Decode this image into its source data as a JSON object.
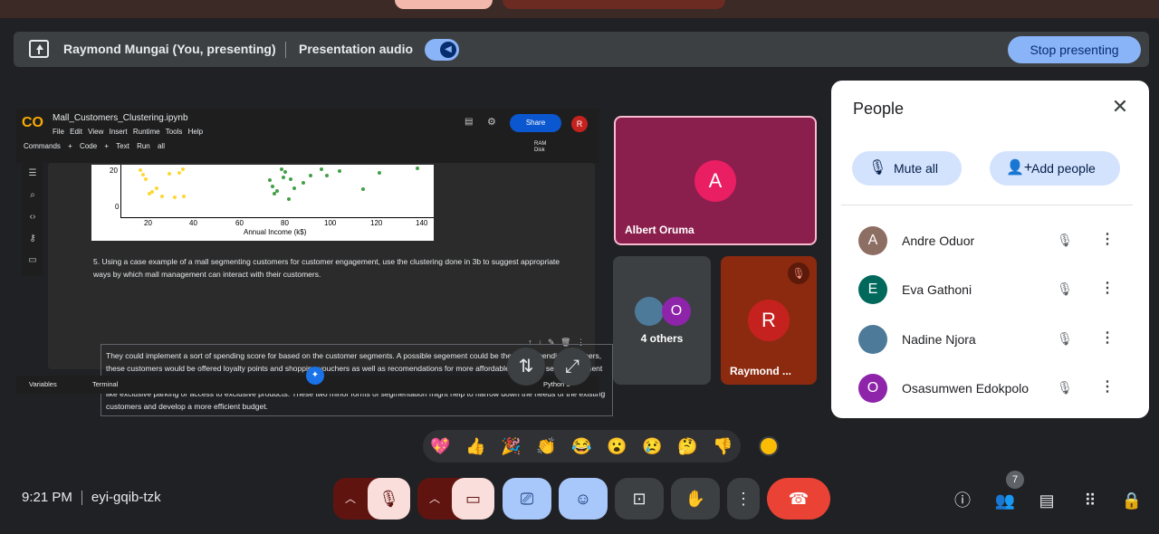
{
  "presenting_bar": {
    "presenter_name": "Raymond Mungai (You, presenting)",
    "audio_label": "Presentation audio",
    "audio_on": true,
    "stop_label": "Stop presenting"
  },
  "colab": {
    "logo": "CO",
    "title": "Mall_Customers_Clustering.ipynb",
    "menu": [
      "File",
      "Edit",
      "View",
      "Insert",
      "Runtime",
      "Tools",
      "Help"
    ],
    "share_label": "Share",
    "avatar_initial": "R",
    "toolbar": [
      "Commands",
      "+ Code",
      "+ Text",
      "Run all"
    ],
    "resources": "RAM\nDisk",
    "plot": {
      "xlabel": "Annual Income (k$)",
      "xticks": [
        "20",
        "40",
        "60",
        "80",
        "100",
        "120",
        "140"
      ],
      "yticks": [
        "20",
        "0"
      ]
    },
    "question": "5. Using a case example of a mall segmenting customers for customer engagement, use the clustering done in 3b to suggest appropriate ways by which mall management can interact with their customers.",
    "answer": "They could implement a sort of spending score for based on the customer segments. A possible segement could be the lower spending shoppers, these customers would be offered loyalty points and shopping vouchers as well as recomendations for more affordable brands. a second segment could be the high spending customers, these are the ones who would be opting for luxury items. These customers might be offered special perks like exclusive parking or access to exclusive products. These two minor forms of segmentation might help to narrow down the needs of the existing customers and develop a more efficient budget.",
    "status": {
      "variables": "Variables",
      "terminal": "Terminal",
      "python": "Python 3"
    }
  },
  "tiles": {
    "albert": {
      "initial": "A",
      "name": "Albert Oruma",
      "color": "#e91e63"
    },
    "others": {
      "label": "4 others",
      "initial": "O"
    },
    "raymond": {
      "initial": "R",
      "name": "Raymond ...",
      "color": "#c5221f"
    }
  },
  "people_panel": {
    "title": "People",
    "mute_all_label": "Mute all",
    "add_people_label": "Add people",
    "people": [
      {
        "initial": "A",
        "name": "Andre Oduor",
        "color": "#8d6e63"
      },
      {
        "initial": "E",
        "name": "Eva Gathoni",
        "color": "#00695c"
      },
      {
        "initial": "",
        "name": "Nadine Njora",
        "color": "#4e7a9a"
      },
      {
        "initial": "O",
        "name": "Osasumwen Edokpolo",
        "color": "#8e24aa"
      }
    ]
  },
  "reactions": [
    "💖",
    "👍",
    "🎉",
    "👏",
    "😂",
    "😮",
    "😢",
    "🤔",
    "👎"
  ],
  "meeting": {
    "time": "9:21 PM",
    "code": "eyi-gqib-tzk"
  },
  "participants_count": "7",
  "colors": {
    "accent": "#8ab4f8",
    "end_call": "#ea4335",
    "muted": "#f9dedc"
  }
}
